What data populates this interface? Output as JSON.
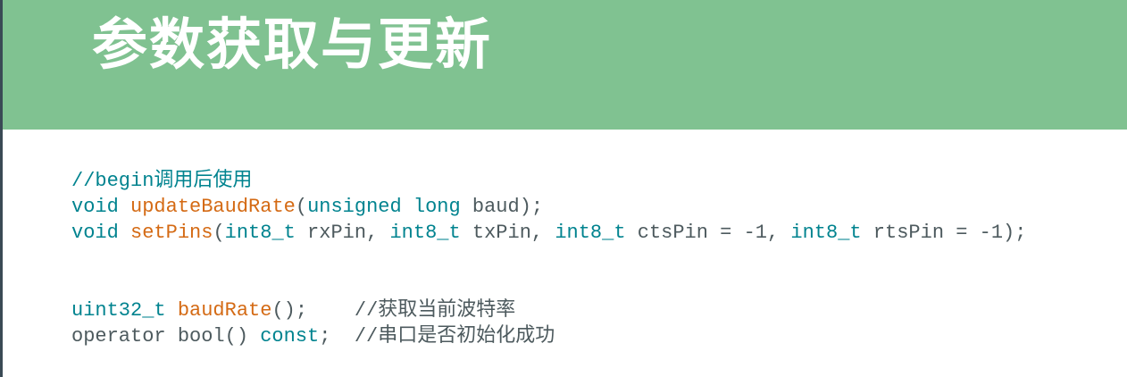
{
  "slide": {
    "title": "参数获取与更新"
  },
  "colors": {
    "header": "#80c291",
    "keyword": "#00838f",
    "function": "#d46a14",
    "plain": "#4d5a5e"
  },
  "code": {
    "lines": [
      [
        {
          "t": "//begin调用后使用",
          "c": "cm"
        }
      ],
      [
        {
          "t": "void ",
          "c": "kw"
        },
        {
          "t": "updateBaudRate",
          "c": "fn"
        },
        {
          "t": "(",
          "c": "pl"
        },
        {
          "t": "unsigned long",
          "c": "kw"
        },
        {
          "t": " baud);",
          "c": "pl"
        }
      ],
      [
        {
          "t": "void ",
          "c": "kw"
        },
        {
          "t": "setPins",
          "c": "fn"
        },
        {
          "t": "(",
          "c": "pl"
        },
        {
          "t": "int8_t",
          "c": "kw"
        },
        {
          "t": " rxPin, ",
          "c": "pl"
        },
        {
          "t": "int8_t",
          "c": "kw"
        },
        {
          "t": " txPin, ",
          "c": "pl"
        },
        {
          "t": "int8_t",
          "c": "kw"
        },
        {
          "t": " ctsPin = -1, ",
          "c": "pl"
        },
        {
          "t": "int8_t",
          "c": "kw"
        },
        {
          "t": " rtsPin = -1);",
          "c": "pl"
        }
      ],
      [],
      [],
      [
        {
          "t": "uint32_t ",
          "c": "kw"
        },
        {
          "t": "baudRate",
          "c": "fn"
        },
        {
          "t": "();    ",
          "c": "pl"
        },
        {
          "t": "//获取当前波特率",
          "c": "pl"
        }
      ],
      [
        {
          "t": "operator bool() ",
          "c": "pl"
        },
        {
          "t": "const",
          "c": "kw"
        },
        {
          "t": ";  ",
          "c": "pl"
        },
        {
          "t": "//串口是否初始化成功",
          "c": "pl"
        }
      ]
    ]
  }
}
